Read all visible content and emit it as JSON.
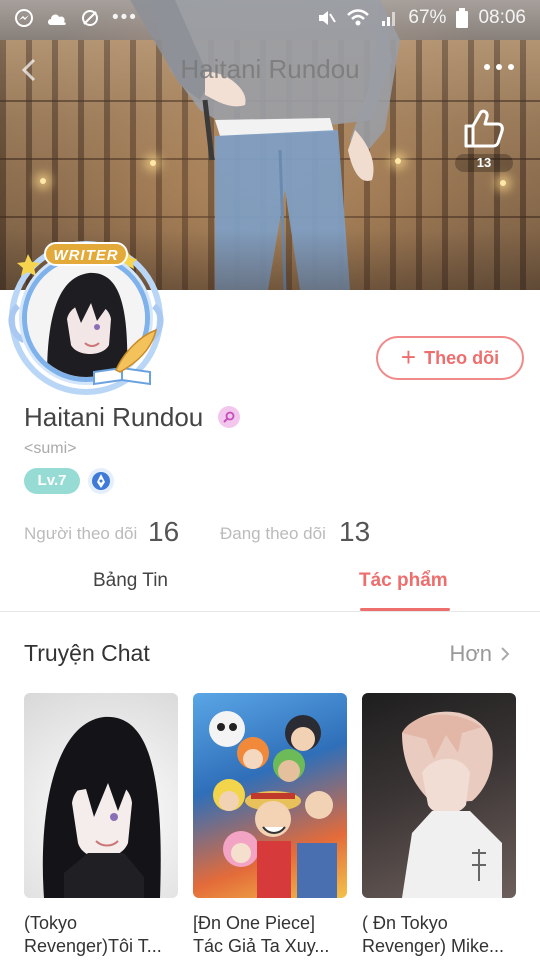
{
  "status_bar": {
    "battery": "67%",
    "time": "08:06"
  },
  "header": {
    "title": "Haitani Rundou",
    "likes": "13"
  },
  "profile": {
    "writer_badge": "WRITER",
    "name": "Haitani Rundou",
    "handle": "<sumi>",
    "level": "Lv.7",
    "follow_label": "Theo dõi",
    "followers_label": "Người theo dõi",
    "followers_count": "16",
    "following_label": "Đang theo dõi",
    "following_count": "13"
  },
  "tabs": [
    {
      "label": "Bảng Tin",
      "active": false
    },
    {
      "label": "Tác phẩm",
      "active": true
    }
  ],
  "section": {
    "title": "Truyện Chat",
    "more_label": "Hơn"
  },
  "stories": [
    {
      "line1": "(Tokyo",
      "line2": "Revenger)Tôi T..."
    },
    {
      "line1": "[Đn One Piece]",
      "line2": "Tác Giả Ta Xuy..."
    },
    {
      "line1": "( Đn Tokyo",
      "line2": "Revenger) Mike..."
    }
  ],
  "colors": {
    "accent": "#ee6e6e",
    "level": "#96dcd4",
    "avatar_ring": "#7fb1ea"
  }
}
